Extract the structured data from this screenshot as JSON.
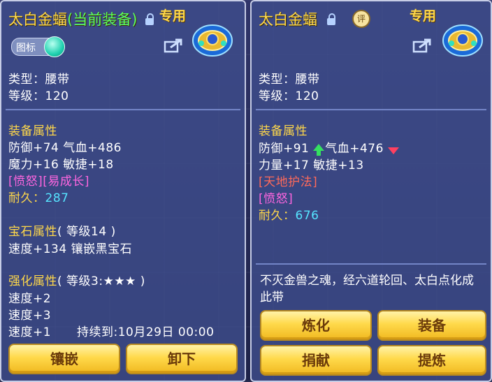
{
  "left": {
    "title": "太白金蝠",
    "title_suffix": "(当前装备)",
    "special_label": "专用",
    "icon_toggle_label": "图标",
    "type_line": "类型：腰带",
    "level_line": "等级：120",
    "equip_attr_heading": "装备属性",
    "attr_line1": "防御+74 气血+486",
    "attr_line2": "魔力+16 敏捷+18",
    "tags": "[愤怒][易成长]",
    "durability_label": "耐久：",
    "durability_value": "287",
    "gem_heading": "宝石属性",
    "gem_level": "( 等级14 )",
    "gem_line": "速度+134 镶嵌黑宝石",
    "enhance_heading": "强化属性",
    "enhance_level": "( 等级3:★★★ )",
    "enhance_lines": [
      "速度+2",
      "速度+3",
      "速度+1"
    ],
    "duration": "持续到:10月29日 00:00",
    "buttons": [
      "镶嵌",
      "卸下"
    ]
  },
  "right": {
    "title": "太白金蝠",
    "rate_label": "评",
    "special_label": "专用",
    "type_line": "类型：腰带",
    "level_line": "等级：120",
    "equip_attr_heading": "装备属性",
    "attr_def": "防御+91",
    "attr_hp": "气血+476",
    "attr_line2": "力量+17 敏捷+13",
    "tag1": "[天地护法]",
    "tag2": "[愤怒]",
    "durability_label": "耐久：",
    "durability_value": "676",
    "description": "不灭金兽之魂，经六道轮回、太白点化成此带",
    "buttons": [
      "炼化",
      "装备",
      "捐献",
      "提炼"
    ]
  },
  "colors": {
    "title": "#ffd84a",
    "current_equipped": "#5cff5c",
    "section_heading": "#ffd84a",
    "durability_value": "#56e4ff",
    "special_tag": "#ff66e0",
    "special_skill": "#ff6a5a",
    "up_arrow": "#35e060",
    "down_arrow": "#ff4060"
  },
  "icons": [
    "lock-icon",
    "share-icon",
    "belt-item-icon",
    "rate-icon",
    "icon-toggle",
    "arrow-up-icon",
    "arrow-down-icon"
  ]
}
